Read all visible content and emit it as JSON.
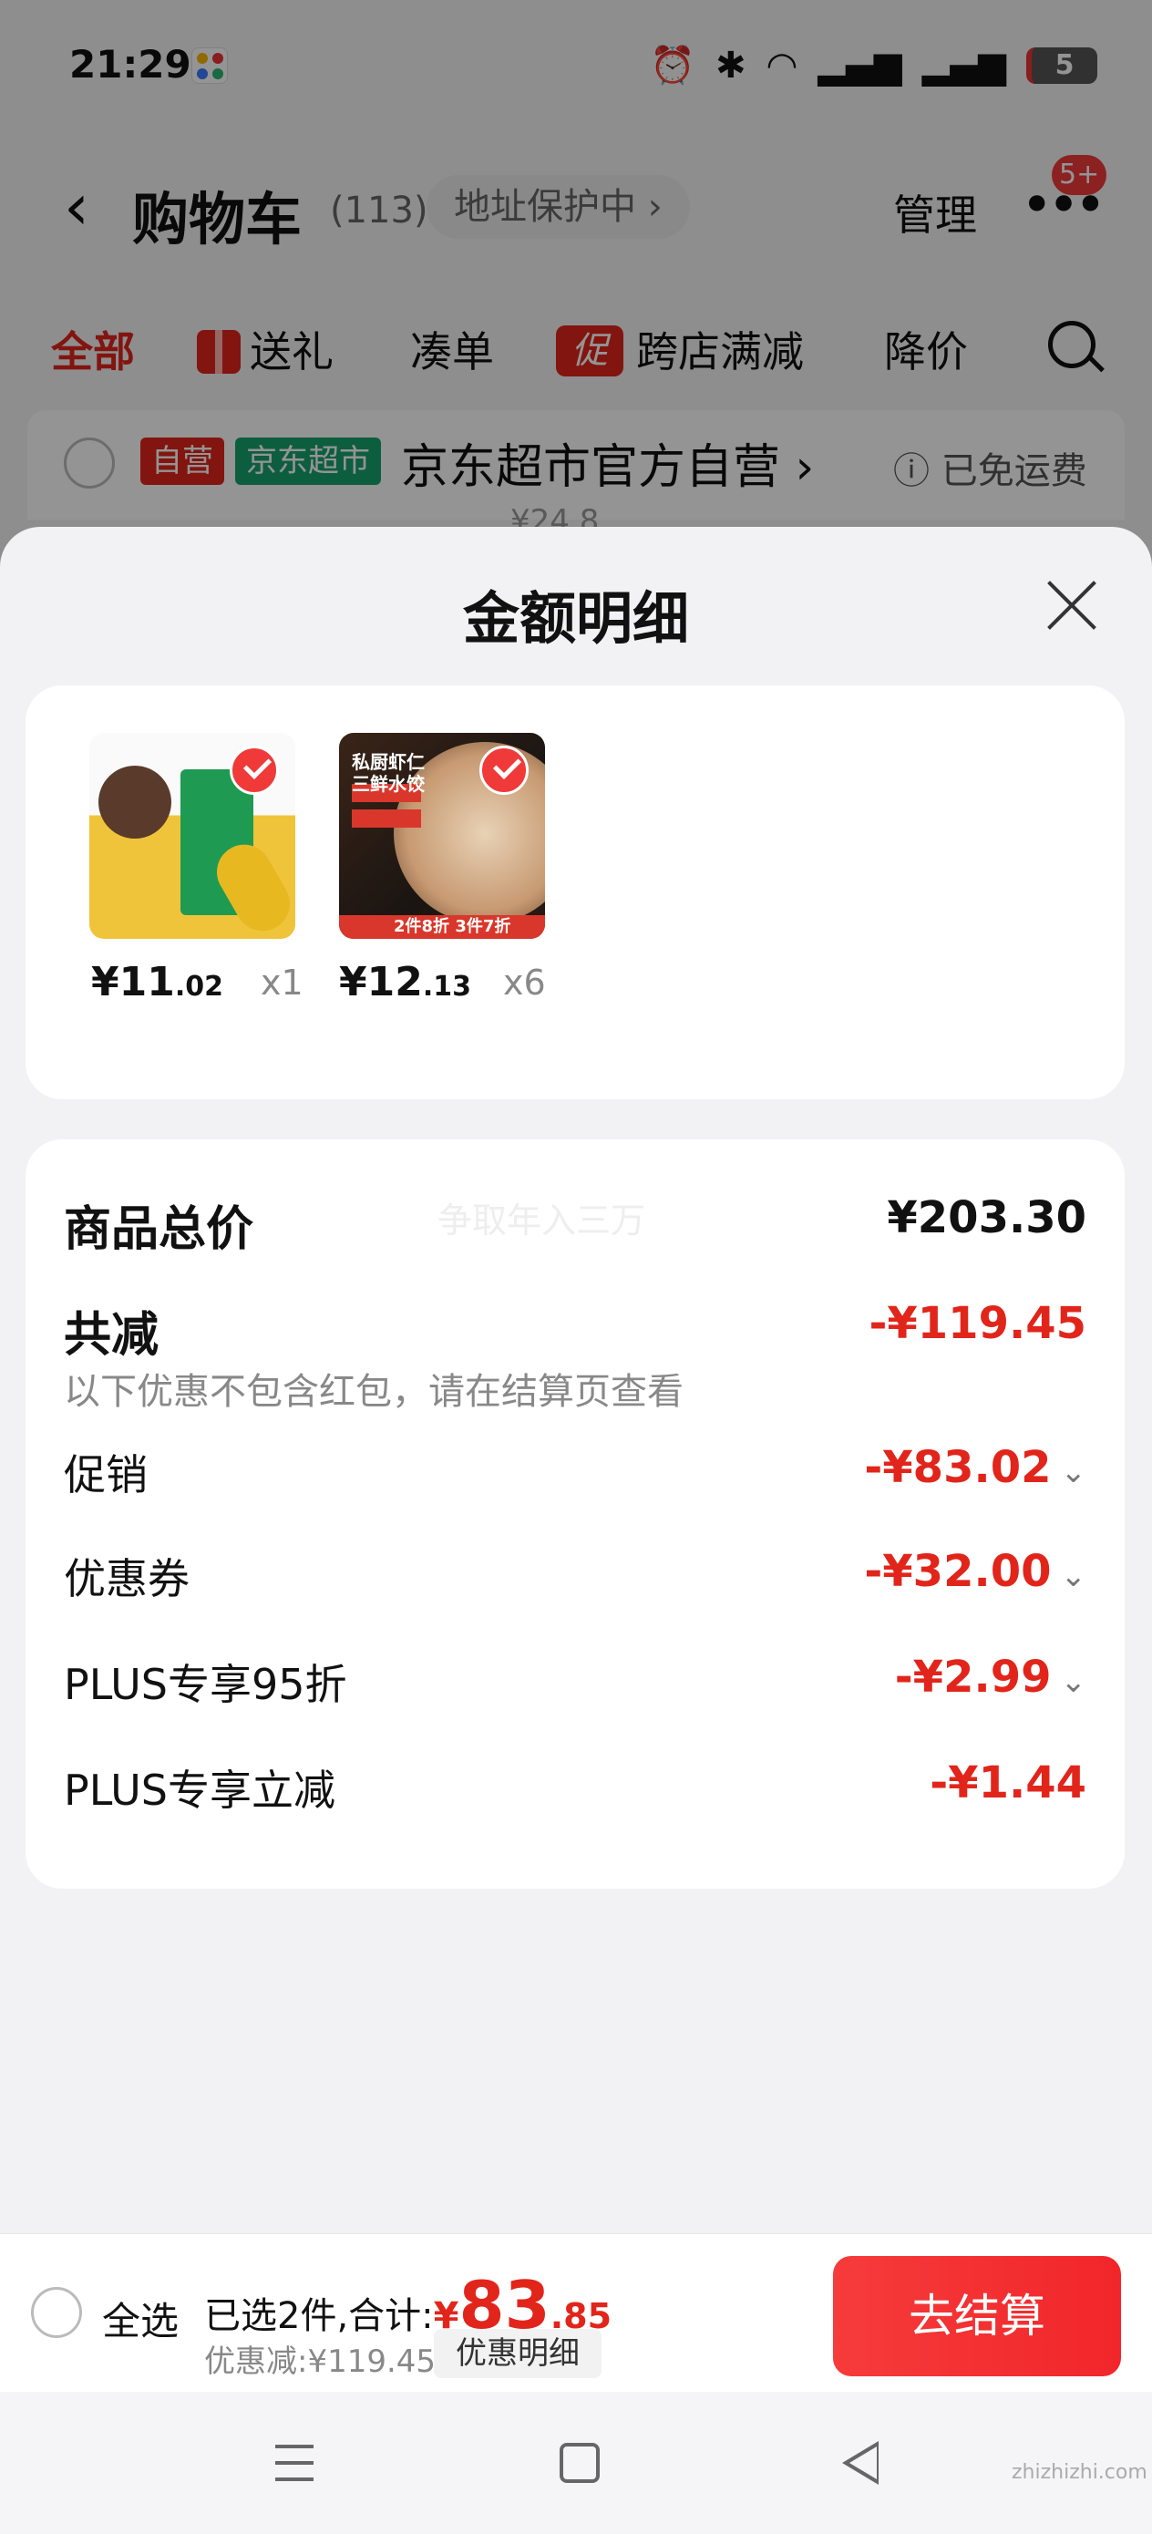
{
  "status_bar": {
    "time": "21:29",
    "battery": "5",
    "icons": [
      "alarm-icon",
      "bluetooth-icon",
      "wifi-icon",
      "signal-5g-icon",
      "signal-5g-icon",
      "battery-icon"
    ]
  },
  "header": {
    "title": "购物车",
    "count": "(113)",
    "address_chip": "地址保护中 ›",
    "manage": "管理",
    "more": "•••",
    "badge": "5+"
  },
  "tabs": [
    {
      "label": "全部",
      "active": true
    },
    {
      "label": "送礼",
      "icon": "gift-icon"
    },
    {
      "label": "凑单"
    },
    {
      "label": "跨店满减",
      "icon_text": "促"
    },
    {
      "label": "降价"
    }
  ],
  "store": {
    "tag_self": "自营",
    "tag_market": "京东超市",
    "name": "京东超市官方自营 ›",
    "shipping": "ⓘ 已免运费",
    "under_price": "¥24.8"
  },
  "sheet": {
    "title": "金额明细",
    "products": [
      {
        "price_main": "¥11",
        "price_cents": ".02",
        "qty": "x1",
        "image": "rice-corn-product"
      },
      {
        "price_main": "¥12",
        "price_cents": ".13",
        "qty": "x6",
        "image": "shrimp-dumpling-product",
        "img_text": "私厨虾仁\n三鲜水饺",
        "img_strip": "2件8折 3件7折"
      }
    ],
    "detail": {
      "total_label": "商品总价",
      "total_value": "¥203.30",
      "watermark": "争取年入三万",
      "reduce_label": "共减",
      "reduce_value": "-¥119.45",
      "reduce_note": "以下优惠不包含红包，请在结算页查看",
      "rows": [
        {
          "label": "促销",
          "value": "-¥83.02",
          "expandable": true
        },
        {
          "label": "优惠券",
          "value": "-¥32.00",
          "expandable": true
        },
        {
          "label": "PLUS专享95折",
          "value": "-¥2.99",
          "expandable": true
        },
        {
          "label": "PLUS专享立减",
          "value": "-¥1.44",
          "expandable": false
        }
      ]
    }
  },
  "checkout_bar": {
    "select_all": "全选",
    "selected_text": "已选2件,合计:",
    "yen": "¥",
    "total_int": "83",
    "total_dec": ".85",
    "discount_text": "优惠减:¥119.45",
    "detail_chip": "优惠明细",
    "checkout_button": "去结算"
  },
  "site_watermark": "zhizhizhi.com",
  "colors": {
    "accent": "#e1251b",
    "checkout_button": "#f1262a",
    "green_tag": "#15a36b"
  }
}
